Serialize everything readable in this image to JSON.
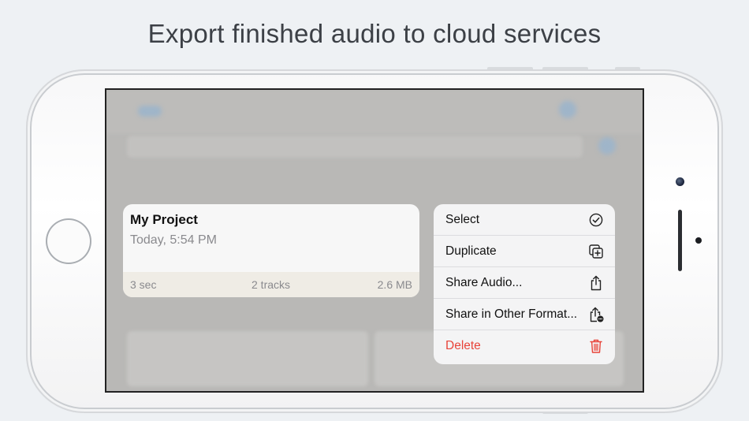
{
  "headline": "Export finished audio to cloud services",
  "project_card": {
    "title": "My Project",
    "date": "Today, 5:54 PM",
    "duration": "3 sec",
    "tracks": "2 tracks",
    "size": "2.6 MB"
  },
  "context_menu": {
    "items": [
      {
        "label": "Select",
        "icon": "checkmark-circle-icon"
      },
      {
        "label": "Duplicate",
        "icon": "duplicate-icon"
      },
      {
        "label": "Share Audio...",
        "icon": "share-icon"
      },
      {
        "label": "Share in Other Format...",
        "icon": "share-more-icon"
      },
      {
        "label": "Delete",
        "icon": "trash-icon"
      }
    ]
  },
  "colors": {
    "destructive": "#e8443a",
    "menu_text": "#111111",
    "secondary_text": "#8a8a8e"
  }
}
